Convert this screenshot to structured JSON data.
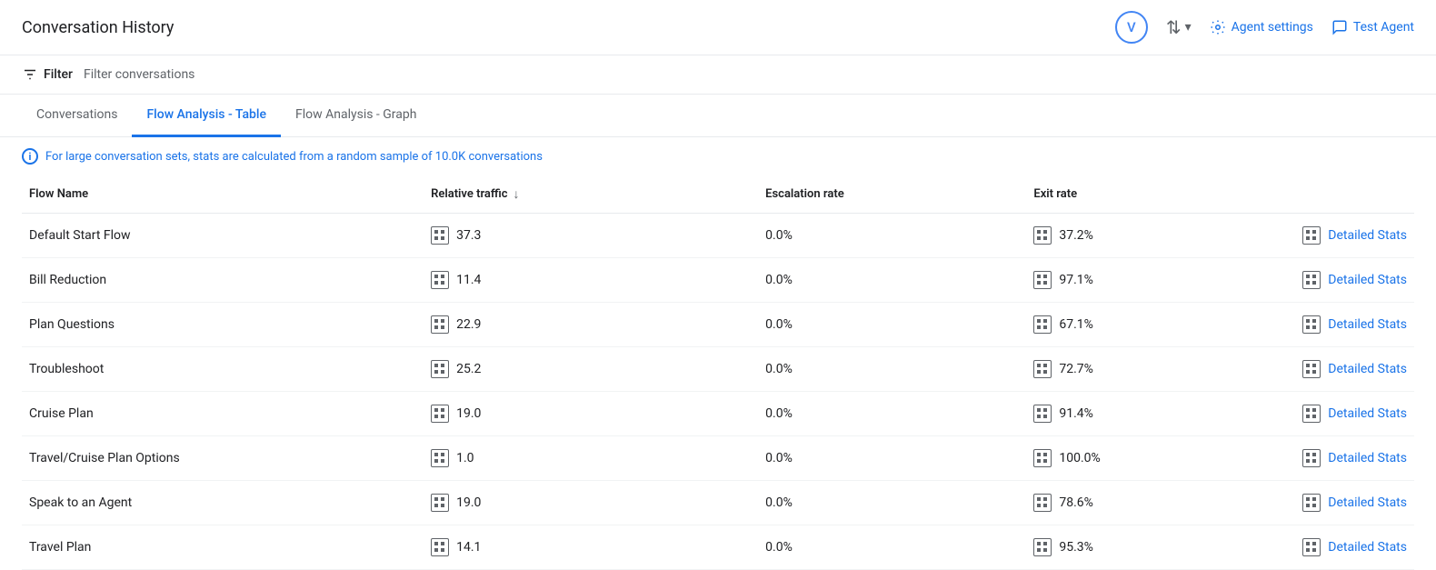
{
  "header": {
    "title": "Conversation History",
    "avatar_label": "V",
    "agent_settings_label": "Agent settings",
    "test_agent_label": "Test Agent"
  },
  "filter": {
    "icon_label": "Filter",
    "placeholder": "Filter conversations"
  },
  "tabs": [
    {
      "id": "conversations",
      "label": "Conversations",
      "active": false
    },
    {
      "id": "flow-analysis-table",
      "label": "Flow Analysis - Table",
      "active": true
    },
    {
      "id": "flow-analysis-graph",
      "label": "Flow Analysis - Graph",
      "active": false
    }
  ],
  "info_message": "For large conversation sets, stats are calculated from a random sample of 10.0K conversations",
  "table": {
    "columns": [
      {
        "id": "flow-name",
        "label": "Flow Name"
      },
      {
        "id": "relative-traffic",
        "label": "Relative traffic",
        "sortable": true
      },
      {
        "id": "escalation-rate",
        "label": "Escalation rate"
      },
      {
        "id": "exit-rate",
        "label": "Exit rate"
      }
    ],
    "rows": [
      {
        "flow_name": "Default Start Flow",
        "relative_traffic": "37.3",
        "escalation_rate": "0.0%",
        "exit_rate": "37.2%",
        "action": "Detailed Stats"
      },
      {
        "flow_name": "Bill Reduction",
        "relative_traffic": "11.4",
        "escalation_rate": "0.0%",
        "exit_rate": "97.1%",
        "action": "Detailed Stats"
      },
      {
        "flow_name": "Plan Questions",
        "relative_traffic": "22.9",
        "escalation_rate": "0.0%",
        "exit_rate": "67.1%",
        "action": "Detailed Stats"
      },
      {
        "flow_name": "Troubleshoot",
        "relative_traffic": "25.2",
        "escalation_rate": "0.0%",
        "exit_rate": "72.7%",
        "action": "Detailed Stats"
      },
      {
        "flow_name": "Cruise Plan",
        "relative_traffic": "19.0",
        "escalation_rate": "0.0%",
        "exit_rate": "91.4%",
        "action": "Detailed Stats"
      },
      {
        "flow_name": "Travel/Cruise Plan Options",
        "relative_traffic": "1.0",
        "escalation_rate": "0.0%",
        "exit_rate": "100.0%",
        "action": "Detailed Stats"
      },
      {
        "flow_name": "Speak to an Agent",
        "relative_traffic": "19.0",
        "escalation_rate": "0.0%",
        "exit_rate": "78.6%",
        "action": "Detailed Stats"
      },
      {
        "flow_name": "Travel Plan",
        "relative_traffic": "14.1",
        "escalation_rate": "0.0%",
        "exit_rate": "95.3%",
        "action": "Detailed Stats"
      }
    ]
  }
}
